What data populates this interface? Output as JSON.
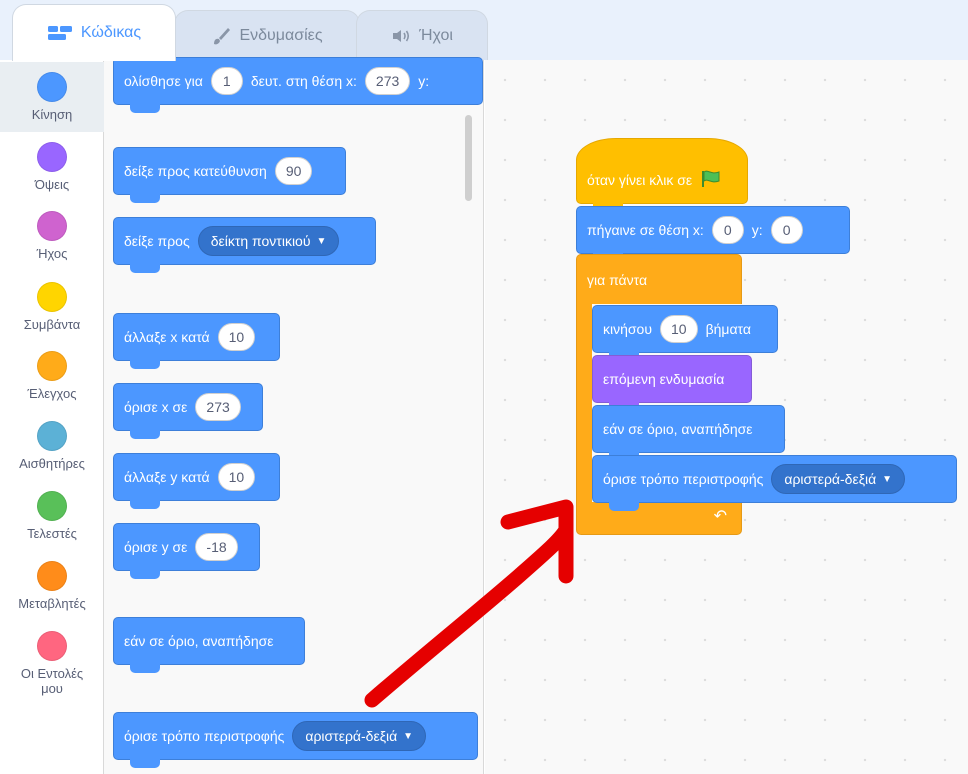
{
  "tabs": [
    {
      "label": "Κώδικας",
      "icon": "code-icon",
      "active": true
    },
    {
      "label": "Ενδυμασίες",
      "icon": "paintbrush-icon",
      "active": false
    },
    {
      "label": "Ήχοι",
      "icon": "speaker-icon",
      "active": false
    }
  ],
  "categories": [
    {
      "label": "Κίνηση",
      "color": "#4c97ff",
      "selected": true
    },
    {
      "label": "Όψεις",
      "color": "#9966ff"
    },
    {
      "label": "Ήχος",
      "color": "#cf63cf"
    },
    {
      "label": "Συμβάντα",
      "color": "#ffd500"
    },
    {
      "label": "Έλεγχος",
      "color": "#ffab19"
    },
    {
      "label": "Αισθητήρες",
      "color": "#5cb1d6"
    },
    {
      "label": "Τελεστές",
      "color": "#59c059"
    },
    {
      "label": "Μεταβλητές",
      "color": "#ff8c1a"
    },
    {
      "label": "Οι Εντολές μου",
      "color": "#ff6680"
    }
  ],
  "palette": {
    "glide": {
      "text": "ολίσθησε για",
      "secs": "1",
      "mid": "δευτ. στη θέση x:",
      "x": "273",
      "y_label": "y:"
    },
    "point_direction": {
      "text": "δείξε προς κατεύθυνση",
      "value": "90"
    },
    "point_towards": {
      "text": "δείξε προς",
      "option": "δείκτη ποντικιού"
    },
    "change_x": {
      "text": "άλλαξε x κατά",
      "value": "10"
    },
    "set_x": {
      "text": "όρισε x σε",
      "value": "273"
    },
    "change_y": {
      "text": "άλλαξε y κατά",
      "value": "10"
    },
    "set_y": {
      "text": "όρισε y σε",
      "value": "-18"
    },
    "bounce": {
      "text": "εάν σε όριο, αναπήδησε"
    },
    "rotation_style": {
      "text": "όρισε τρόπο περιστροφής",
      "option": "αριστερά-δεξιά"
    }
  },
  "script": {
    "when_flag": {
      "text": "όταν γίνει κλικ σε"
    },
    "goto_xy": {
      "text": "πήγαινε σε θέση x:",
      "x": "0",
      "y_label": "y:",
      "y": "0"
    },
    "forever": {
      "text": "για πάντα"
    },
    "move": {
      "text": "κινήσου",
      "steps": "10",
      "suffix": "βήματα"
    },
    "next_costume": {
      "text": "επόμενη ενδυμασία"
    },
    "bounce": {
      "text": "εάν σε όριο, αναπήδησε"
    },
    "rotation_style": {
      "text": "όρισε τρόπο περιστροφής",
      "option": "αριστερά-δεξιά"
    }
  },
  "colors": {
    "motion": "#4c97ff",
    "looks": "#9966ff",
    "events": "#ffbf00",
    "control": "#ffab19",
    "annotation_arrow": "#e50000"
  }
}
